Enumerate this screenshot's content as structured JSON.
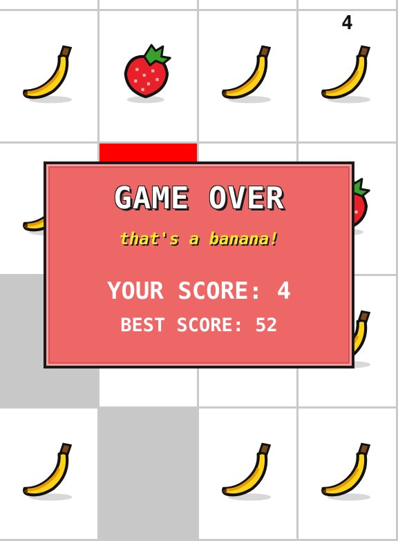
{
  "hud": {
    "score": "4"
  },
  "game_over": {
    "title": "GAME OVER",
    "subtitle": "that's a banana!",
    "your_score": "YOUR SCORE: 4",
    "best_score": "BEST SCORE: 52"
  },
  "colors": {
    "dialog_bg": "#ee6767",
    "dialog_border": "#1a1a1a",
    "subtitle_yellow": "#ffe92a",
    "wrong_tile_red": "#ff0000",
    "empty_tile_gray": "#c8c8c8",
    "grid_line": "#c9c9c9"
  },
  "grid": {
    "columns": 4,
    "rows": [
      [
        "empty",
        "empty",
        "empty",
        "empty"
      ],
      [
        "banana",
        "strawberry",
        "banana",
        "banana"
      ],
      [
        "banana",
        "red",
        "empty",
        "strawberry"
      ],
      [
        "gray",
        "empty",
        "empty",
        "banana"
      ],
      [
        "banana",
        "gray",
        "banana",
        "banana"
      ]
    ]
  }
}
